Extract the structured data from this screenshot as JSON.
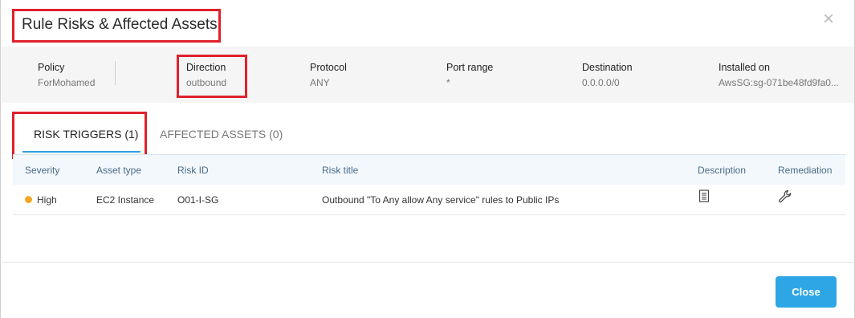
{
  "modal": {
    "title": "Rule Risks & Affected Assets",
    "close_icon": "close-icon"
  },
  "info": {
    "policy": {
      "label": "Policy",
      "value": "ForMohamed"
    },
    "direction": {
      "label": "Direction",
      "value": "outbound"
    },
    "protocol": {
      "label": "Protocol",
      "value": "ANY"
    },
    "port_range": {
      "label": "Port range",
      "value": "*"
    },
    "destination": {
      "label": "Destination",
      "value": "0.0.0.0/0"
    },
    "installed_on": {
      "label": "Installed on",
      "value": "AwsSG:sg-071be48fd9fa0..."
    }
  },
  "tabs": [
    {
      "label": "RISK TRIGGERS (1)",
      "active": true
    },
    {
      "label": "AFFECTED ASSETS (0)",
      "active": false
    }
  ],
  "table": {
    "headers": [
      "Severity",
      "Asset type",
      "Risk ID",
      "Risk title",
      "Description",
      "Remediation"
    ],
    "rows": [
      {
        "severity": "High",
        "severity_color": "#f5a623",
        "asset_type": "EC2 Instance",
        "risk_id": "O01-I-SG",
        "risk_title": "Outbound \"To Any allow Any service\" rules to Public IPs",
        "description_icon": "document-icon",
        "remediation_icon": "wrench-icon"
      }
    ]
  },
  "footer": {
    "close_label": "Close",
    "close_color": "#2ea6e5"
  },
  "colors": {
    "highlight": "#e0202d",
    "accent": "#2e9fe0"
  }
}
